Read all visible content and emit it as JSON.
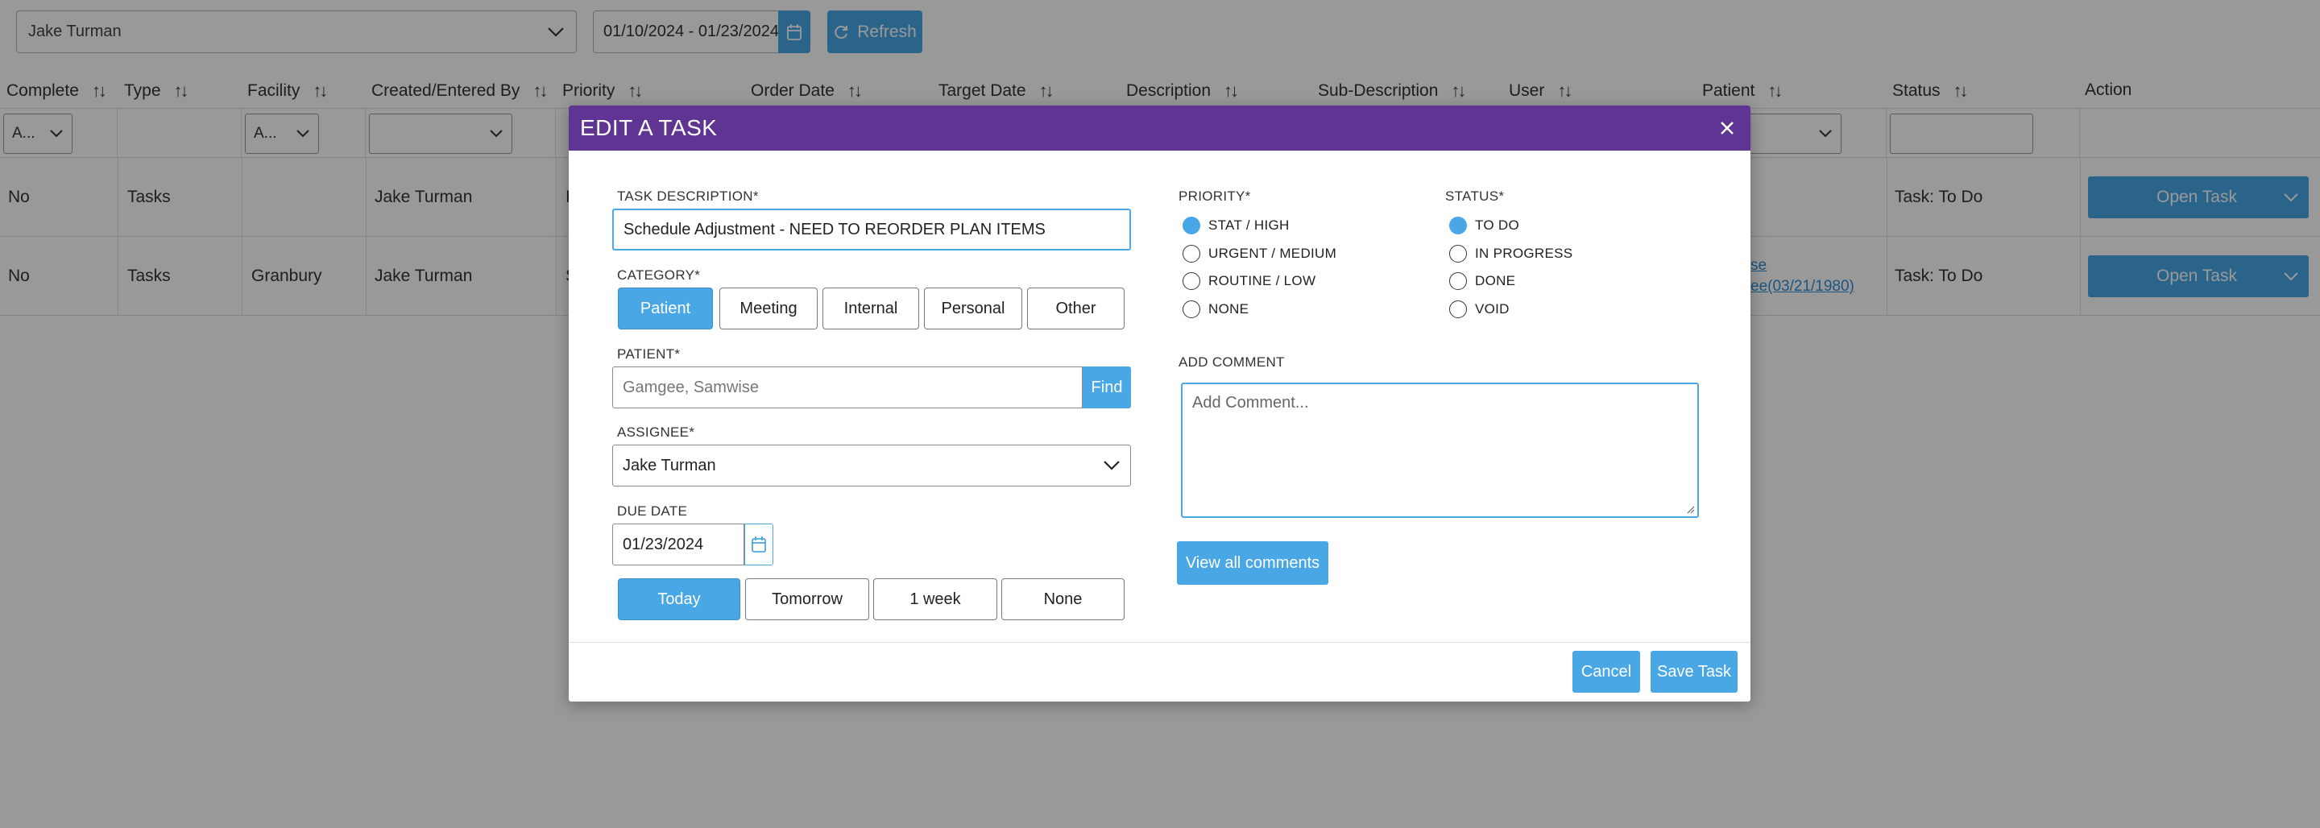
{
  "toolbar": {
    "user_select": "Jake Turman",
    "date_range": "01/10/2024 - 01/23/2024",
    "refresh_label": "Refresh"
  },
  "table": {
    "columns": [
      "Complete",
      "Type",
      "Facility",
      "Created/Entered By",
      "Priority",
      "Order Date",
      "Target Date",
      "Description",
      "Sub-Description",
      "User",
      "Patient",
      "Status",
      "Action"
    ],
    "filters": {
      "complete": "A...",
      "facility": "A..."
    },
    "rows": [
      {
        "complete": "No",
        "type": "Tasks",
        "facility": "",
        "created_by": "Jake Turman",
        "priority": "I",
        "patient": "",
        "status": "Task: To Do",
        "action": "Open Task"
      },
      {
        "complete": "No",
        "type": "Tasks",
        "facility": "Granbury",
        "created_by": "Jake Turman",
        "priority": "S",
        "patient_line1": "se",
        "patient_line2": "ee(03/21/1980)",
        "status": "Task: To Do",
        "action": "Open Task"
      }
    ]
  },
  "modal": {
    "title": "EDIT A TASK",
    "task_description": {
      "label": "TASK DESCRIPTION*",
      "value": "Schedule Adjustment - NEED TO REORDER PLAN ITEMS"
    },
    "category": {
      "label": "CATEGORY*",
      "options": [
        "Patient",
        "Meeting",
        "Internal",
        "Personal",
        "Other"
      ],
      "selected": "Patient"
    },
    "patient": {
      "label": "PATIENT*",
      "placeholder": "Gamgee, Samwise",
      "find_label": "Find"
    },
    "assignee": {
      "label": "ASSIGNEE*",
      "value": "Jake Turman"
    },
    "due_date": {
      "label": "DUE DATE",
      "value": "01/23/2024",
      "quick_options": [
        "Today",
        "Tomorrow",
        "1 week",
        "None"
      ],
      "selected": "Today"
    },
    "priority": {
      "label": "PRIORITY*",
      "options": [
        "STAT / HIGH",
        "URGENT / MEDIUM",
        "ROUTINE / LOW",
        "NONE"
      ],
      "selected": "STAT / HIGH"
    },
    "status": {
      "label": "STATUS*",
      "options": [
        "TO DO",
        "IN PROGRESS",
        "DONE",
        "VOID"
      ],
      "selected": "TO DO"
    },
    "comment": {
      "label": "ADD COMMENT",
      "placeholder": "Add Comment..."
    },
    "view_comments_label": "View all comments",
    "cancel_label": "Cancel",
    "save_label": "Save Task"
  },
  "colors": {
    "accent": "#49a7e6",
    "header": "#5f3492",
    "overlay": "rgba(0,0,0,0.4)"
  }
}
